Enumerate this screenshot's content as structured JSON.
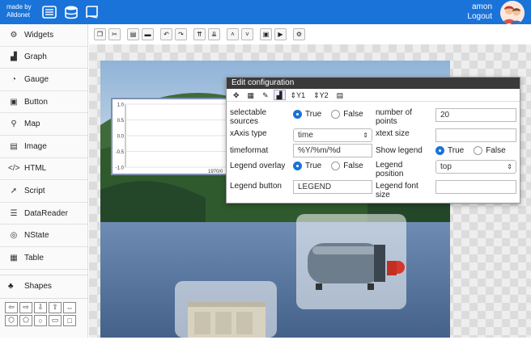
{
  "brand": {
    "line1": "made by",
    "line2": "Alldonet"
  },
  "user": {
    "name": "amon",
    "logout": "Logout"
  },
  "sidebar": {
    "items": [
      {
        "label": "Widgets",
        "icon": "gears-icon"
      },
      {
        "label": "Graph",
        "icon": "chart-icon"
      },
      {
        "label": "Gauge",
        "icon": "gauge-icon"
      },
      {
        "label": "Button",
        "icon": "button-icon"
      },
      {
        "label": "Map",
        "icon": "map-pin-icon"
      },
      {
        "label": "Image",
        "icon": "image-icon"
      },
      {
        "label": "HTML",
        "icon": "code-icon"
      },
      {
        "label": "Script",
        "icon": "rocket-icon"
      },
      {
        "label": "DataReader",
        "icon": "database-icon"
      },
      {
        "label": "NState",
        "icon": "nstate-icon"
      },
      {
        "label": "Table",
        "icon": "table-icon"
      }
    ],
    "shapes_label": "Shapes"
  },
  "chart_widget": {
    "yticks": [
      "1.0",
      "0.5",
      "0.0",
      "-0.5",
      "-1.0"
    ],
    "xtick": "1970/0"
  },
  "dialog": {
    "title": "Edit configuration",
    "tabs": [
      "Y1",
      "Y2"
    ],
    "selectable_sources": {
      "label": "selectable sources",
      "true": "True",
      "false": "False"
    },
    "number_of_points": {
      "label": "number of points",
      "value": "20"
    },
    "xaxis_type": {
      "label": "xAxis type",
      "value": "time"
    },
    "xtext_size": {
      "label": "xtext size",
      "value": ""
    },
    "timeformat": {
      "label": "timeformat",
      "value": "%Y/%m/%d"
    },
    "show_legend": {
      "label": "Show legend",
      "true": "True",
      "false": "False"
    },
    "legend_overlay": {
      "label": "Legend overlay",
      "true": "True",
      "false": "False"
    },
    "legend_position": {
      "label": "Legend position",
      "value": "top"
    },
    "legend_button": {
      "label": "Legend button",
      "value": "LEGEND"
    },
    "legend_font_size": {
      "label": "Legend font size",
      "value": ""
    }
  },
  "colors": {
    "accent": "#1a73d9",
    "dialog_title": "#3a3a3a"
  }
}
